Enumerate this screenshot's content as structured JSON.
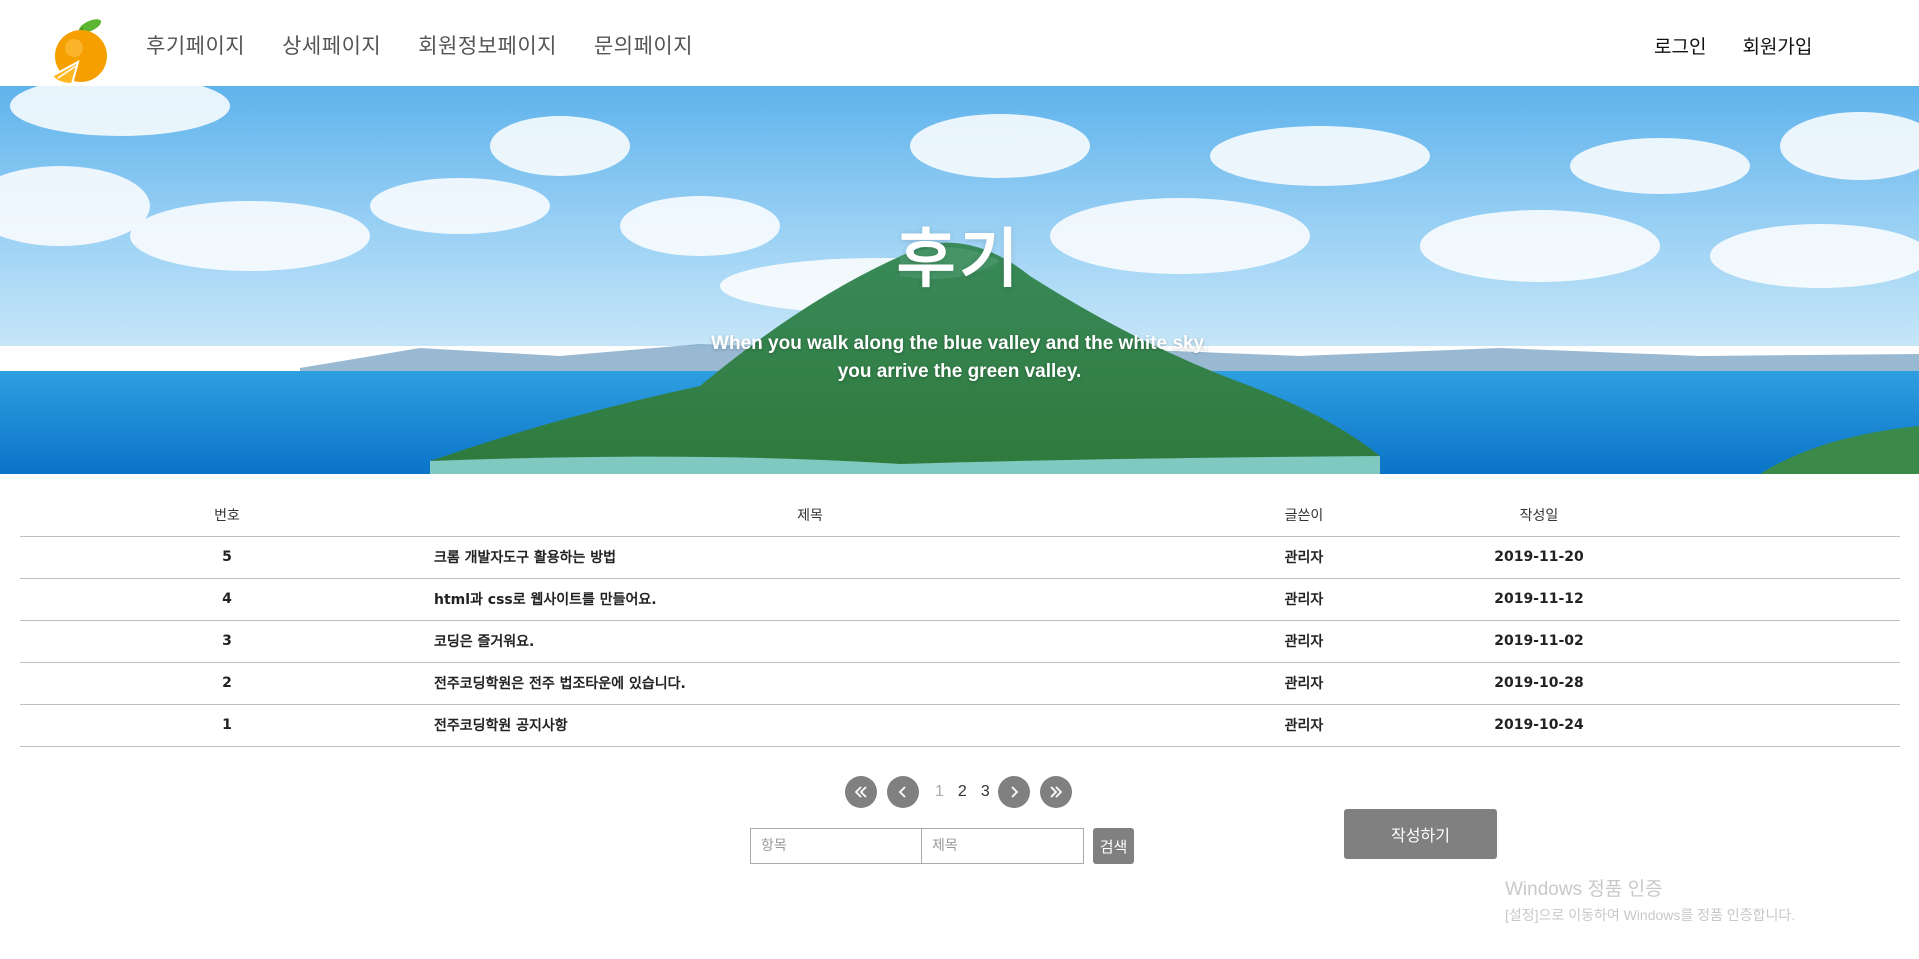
{
  "header": {
    "nav": [
      "후기페이지",
      "상세페이지",
      "회원정보페이지",
      "문의페이지"
    ],
    "login": "로그인",
    "signup": "회원가입"
  },
  "hero": {
    "title": "후기",
    "subtitle_line1": "When you walk along the blue valley and the white sky,",
    "subtitle_line2": "you arrive the green valley."
  },
  "board": {
    "columns": [
      "번호",
      "제목",
      "글쓴이",
      "작성일"
    ],
    "rows": [
      {
        "no": "5",
        "title": "크롬 개발자도구 활용하는 방법",
        "writer": "관리자",
        "date": "2019-11-20"
      },
      {
        "no": "4",
        "title": "html과 css로 웹사이트를 만들어요.",
        "writer": "관리자",
        "date": "2019-11-12"
      },
      {
        "no": "3",
        "title": "코딩은 즐거워요.",
        "writer": "관리자",
        "date": "2019-11-02"
      },
      {
        "no": "2",
        "title": "전주코딩학원은 전주 법조타운에 있습니다.",
        "writer": "관리자",
        "date": "2019-10-28"
      },
      {
        "no": "1",
        "title": "전주코딩학원 공지사항",
        "writer": "관리자",
        "date": "2019-10-24"
      }
    ]
  },
  "pagination": {
    "first_icon": "double-chevron-left-icon",
    "prev_icon": "chevron-left-icon",
    "pages": [
      "1",
      "2",
      "3"
    ],
    "current": "1",
    "next_icon": "chevron-right-icon",
    "last_icon": "double-chevron-right-icon"
  },
  "search": {
    "item_placeholder": "항목",
    "title_placeholder": "제목",
    "button": "검색"
  },
  "write_button": "작성하기",
  "watermark": {
    "line1": "Windows 정품 인증",
    "line2": "[설정]으로 이동하여 Windows를 정품 인증합니다."
  },
  "colors": {
    "button_gray": "#808080",
    "logo_orange": "#f5a000",
    "leaf_green": "#5cb531"
  }
}
